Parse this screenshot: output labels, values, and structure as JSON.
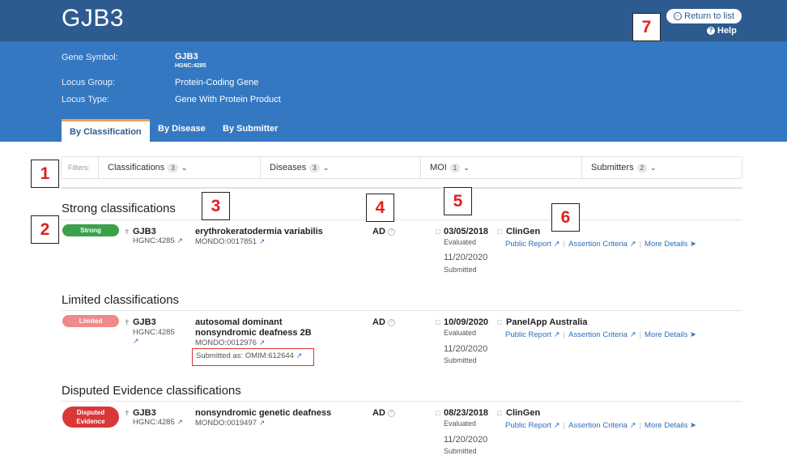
{
  "header": {
    "title": "GJB3",
    "return_label": "Return to list",
    "help_label": "Help"
  },
  "info": {
    "gene_symbol_label": "Gene Symbol:",
    "gene_symbol_value": "GJB3",
    "gene_symbol_sub": "HGNC:4285",
    "locus_group_label": "Locus Group:",
    "locus_group_value": "Protein-Coding Gene",
    "locus_type_label": "Locus Type:",
    "locus_type_value": "Gene With Protein Product"
  },
  "tabs": [
    "By Classification",
    "By Disease",
    "By Submitter"
  ],
  "filters": {
    "label": "Filters:",
    "items": [
      {
        "label": "Classifications",
        "count": "3"
      },
      {
        "label": "Diseases",
        "count": "3"
      },
      {
        "label": "MOI",
        "count": "1"
      },
      {
        "label": "Submitters",
        "count": "2"
      }
    ]
  },
  "sections": [
    {
      "title": "Strong classifications",
      "row": {
        "badge": "Strong",
        "badge_line2": "",
        "gene": "GJB3",
        "hgnc": "HGNC:4285",
        "disease": "erythrokeratodermia variabilis",
        "mondo": "MONDO:0017851",
        "moi": "AD",
        "date": "03/05/2018",
        "date_label": "Evaluated",
        "submitted_date": "11/20/2020",
        "submitted_label": "Submitted",
        "submitter": "ClinGen"
      }
    },
    {
      "title": "Limited classifications",
      "row": {
        "badge": "Limited",
        "badge_line2": "",
        "gene": "GJB3",
        "hgnc": "HGNC:4285",
        "disease": "autosomal dominant nonsyndromic deafness 2B",
        "mondo": "MONDO:0012976",
        "submitted_as": "Submitted as: OMIM:612644",
        "moi": "AD",
        "date": "10/09/2020",
        "date_label": "Evaluated",
        "submitted_date": "11/20/2020",
        "submitted_label": "Submitted",
        "submitter": "PanelApp Australia"
      }
    },
    {
      "title": "Disputed Evidence classifications",
      "row": {
        "badge": "Disputed",
        "badge_line2": "Evidence",
        "gene": "GJB3",
        "hgnc": "HGNC:4285",
        "disease": "nonsyndromic genetic deafness",
        "mondo": "MONDO:0019497",
        "moi": "AD",
        "date": "08/23/2018",
        "date_label": "Evaluated",
        "submitted_date": "11/20/2020",
        "submitted_label": "Submitted",
        "submitter": "ClinGen"
      }
    }
  ],
  "links": {
    "public_report": "Public Report",
    "assertion_criteria": "Assertion Criteria",
    "more_details": "More Details"
  },
  "callouts": [
    "1",
    "2",
    "3",
    "4",
    "5",
    "6",
    "7"
  ],
  "colors": {
    "header_dark": "#2d5b8f",
    "header_light": "#3478c2",
    "strong": "#3aa14a",
    "limited": "#ee8a8a",
    "disputed": "#d93838",
    "link": "#2a6ebf"
  }
}
